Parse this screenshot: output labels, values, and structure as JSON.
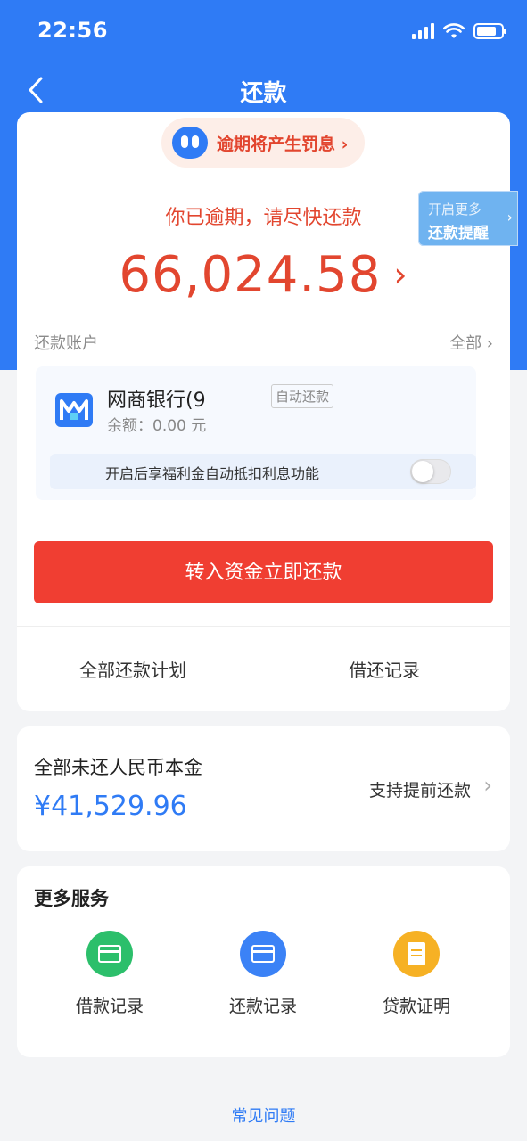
{
  "status_bar": {
    "time": "22:56"
  },
  "nav": {
    "title": "还款"
  },
  "overdue_banner": {
    "text": "逾期将产生罚息 ›"
  },
  "main": {
    "message": "你已逾期，请尽快还款",
    "amount": "66,024.58",
    "amount_chevron": "›"
  },
  "reminder": {
    "line1": "开启更多",
    "line2": "还款提醒",
    "arrow": "›"
  },
  "account": {
    "label": "还款账户",
    "all_label": "全部 ›",
    "bank_name": "网商银行(9",
    "auto_tag": "自动还款",
    "balance": "余额：0.00 元",
    "toggle_text": "开启后享福利金自动抵扣利息功能",
    "toggle_on": false
  },
  "pay_button": "转入资金立即还款",
  "links": {
    "plan": "全部还款计划",
    "records": "借还记录"
  },
  "principal": {
    "label": "全部未还人民币本金",
    "value": "¥41,529.96",
    "advance": "支持提前还款",
    "chevron": "›"
  },
  "services": {
    "title": "更多服务",
    "items": [
      {
        "label": "借款记录",
        "icon": "loan-record-icon",
        "color": "#2cbf6b"
      },
      {
        "label": "还款记录",
        "icon": "repay-record-icon",
        "color": "#3b82f6"
      },
      {
        "label": "贷款证明",
        "icon": "loan-certificate-icon",
        "color": "#f6b124"
      }
    ]
  },
  "faq": "常见问题",
  "colors": {
    "primary": "#2f7bf5",
    "danger": "#f03e32",
    "overdue_text": "#e2462f"
  }
}
